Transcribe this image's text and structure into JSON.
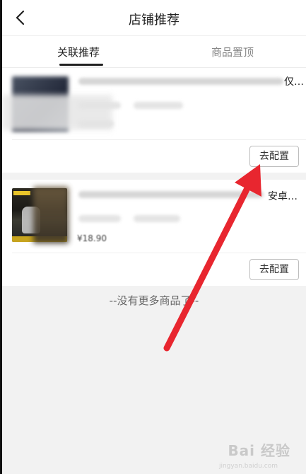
{
  "header": {
    "title": "店铺推荐"
  },
  "tabs": [
    {
      "label": "关联推荐",
      "active": true
    },
    {
      "label": "商品置顶",
      "active": false
    }
  ],
  "products": [
    {
      "title_tail": "仅…",
      "config_label": "去配置"
    },
    {
      "title_tail": "安卓…",
      "price": "¥18.90",
      "config_label": "去配置"
    }
  ],
  "footer": {
    "no_more": "--没有更多商品了--"
  },
  "watermark": {
    "text": "Bai 经验",
    "sub": "jingyan.baidu.com"
  },
  "colors": {
    "annotation_arrow": "#e8262f"
  }
}
